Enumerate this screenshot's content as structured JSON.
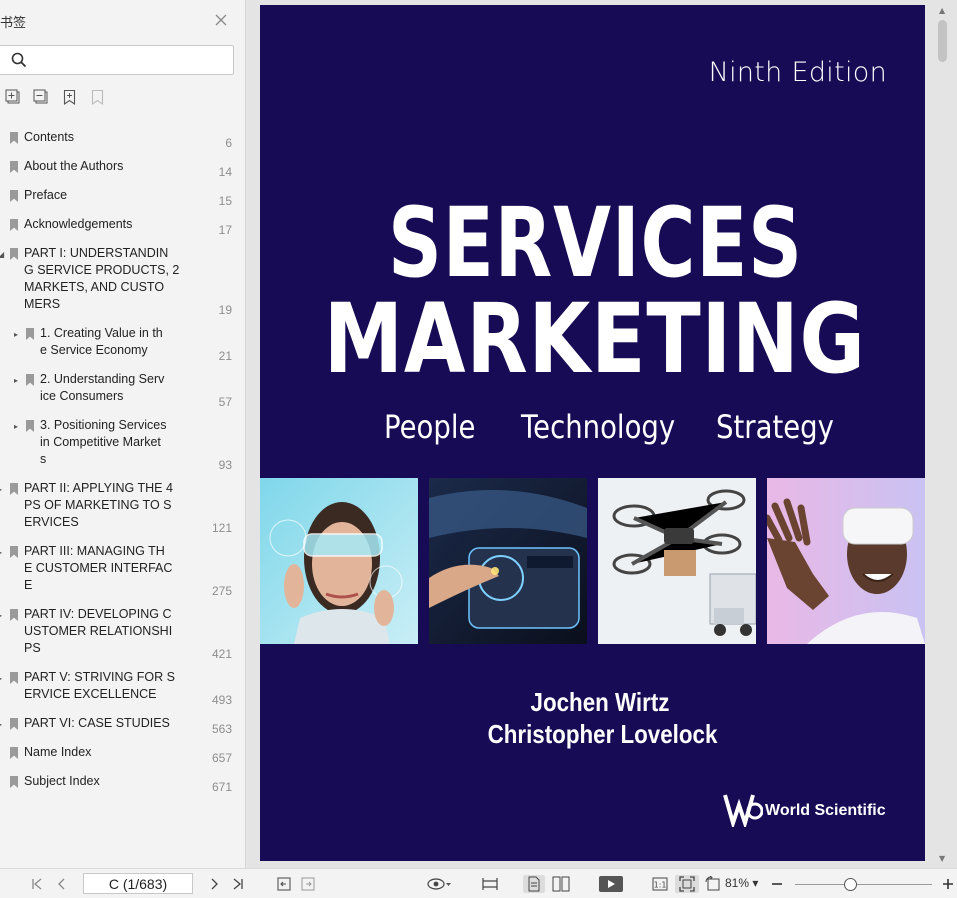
{
  "sidebar": {
    "title": "书签",
    "search_placeholder": "",
    "items": [
      {
        "label": "Contents",
        "page": "6",
        "level": 0
      },
      {
        "label": "About the Authors",
        "page": "14",
        "level": 0
      },
      {
        "label": "Preface",
        "page": "15",
        "level": 0
      },
      {
        "label": "Acknowledgements",
        "page": "17",
        "level": 0
      },
      {
        "label": "PART I: UNDERSTANDIN\nG SERVICE PRODUCTS, 2\nMARKETS, AND CUSTO\nMERS",
        "page": "19",
        "level": 0,
        "expanded": true
      },
      {
        "label": "1. Creating Value in th\ne Service Economy",
        "page": "21",
        "level": 1
      },
      {
        "label": "2. Understanding Serv\nice Consumers",
        "page": "57",
        "level": 1
      },
      {
        "label": "3. Positioning Services\nin Competitive Market\ns",
        "page": "93",
        "level": 1
      },
      {
        "label": "PART II: APPLYING THE 4\nPS OF MARKETING TO S\nERVICES",
        "page": "121",
        "level": 0
      },
      {
        "label": "PART III: MANAGING TH\nE CUSTOMER INTERFAC\nE",
        "page": "275",
        "level": 0
      },
      {
        "label": "PART IV: DEVELOPING C\nUSTOMER RELATIONSHI\nPS",
        "page": "421",
        "level": 0
      },
      {
        "label": "PART V: STRIVING FOR S\nERVICE EXCELLENCE",
        "page": "493",
        "level": 0
      },
      {
        "label": "PART VI: CASE STUDIES",
        "page": "563",
        "level": 0
      },
      {
        "label": "Name Index",
        "page": "657",
        "level": 0
      },
      {
        "label": "Subject Index",
        "page": "671",
        "level": 0
      }
    ]
  },
  "cover": {
    "edition": "Ninth Edition",
    "title_line1": "SERVICES",
    "title_line2": "MARKETING",
    "taglines": [
      "People",
      "Technology",
      "Strategy"
    ],
    "authors": [
      "Jochen Wirtz",
      "Christopher Lovelock"
    ],
    "publisher": "World Scientific",
    "background_color": "#170b55"
  },
  "toolbar": {
    "page_indicator": "C (1/683)",
    "zoom": "81%"
  },
  "colors": {
    "accent": "#170b55"
  }
}
